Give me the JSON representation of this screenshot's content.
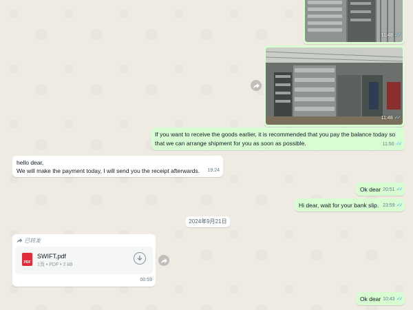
{
  "messages": {
    "photo1": {
      "time": "11:48"
    },
    "photo2": {
      "time": "11:48"
    },
    "msg_balance": {
      "text": "If you want to receive the goods earlier, it is recommended that you pay the balance today so that we can arrange shipment for you as soon as possible.",
      "time": "11:50"
    },
    "msg_hello": {
      "line1": "hello dear,",
      "line2": "We will make the payment today, I will send you the receipt afterwards.",
      "time": "19:24"
    },
    "msg_ok1": {
      "text": "Ok dear",
      "time": "20:51"
    },
    "msg_wait": {
      "text": "Hi dear, wait for your bank slip.",
      "time": "23:59"
    },
    "msg_file": {
      "forwarded_label": "已转发",
      "file_name": "SWIFT.pdf",
      "file_meta": "1页 • PDF • 2 kB",
      "file_icon_label": "PDF",
      "time": "00:59"
    },
    "msg_ok2": {
      "text": "Ok dear",
      "time": "10:43"
    }
  },
  "date_separator": "2024年9月21日",
  "colors": {
    "outgoing": "#d9fdd3",
    "incoming": "#ffffff",
    "read_ticks": "#53bdeb",
    "pdf_red": "#e02c39",
    "chat_bg": "#efeae2"
  },
  "icons": [
    "forward-icon",
    "double-check-icon",
    "download-icon",
    "pdf-file-icon"
  ]
}
